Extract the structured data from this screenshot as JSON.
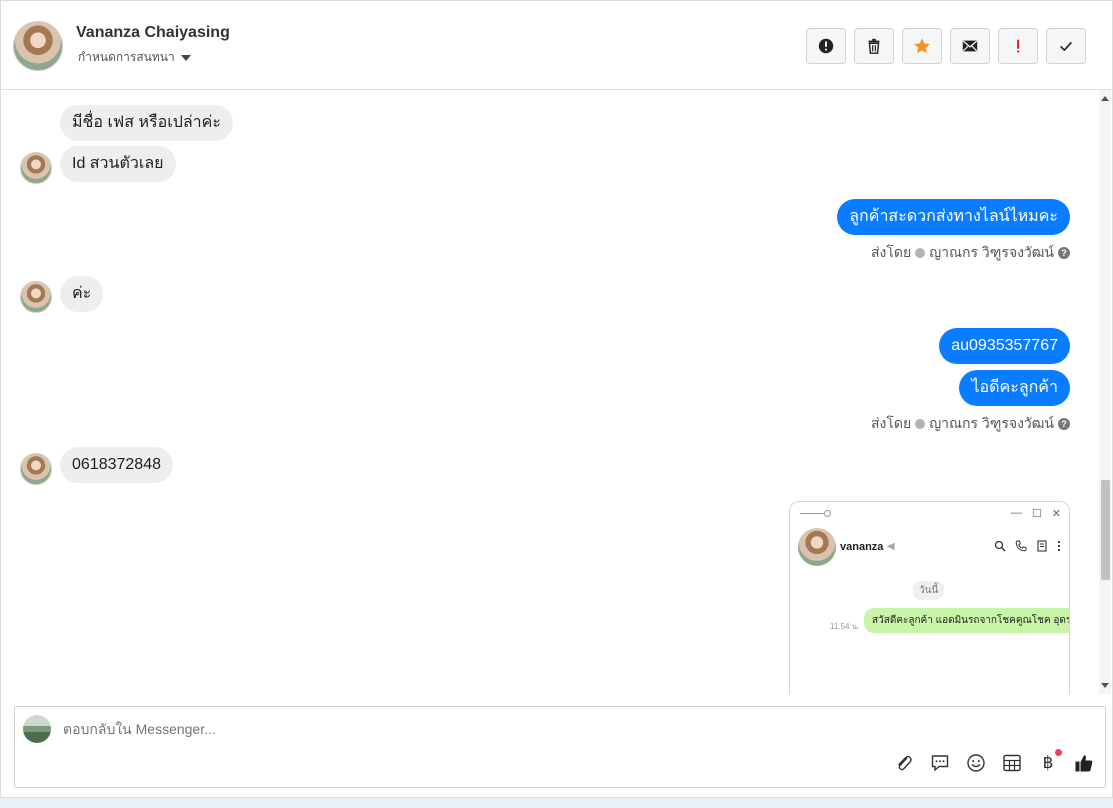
{
  "header": {
    "contact_name": "Vananza Chaiyasing",
    "assign_label": "กำหนดการสนทนา"
  },
  "actions": [
    {
      "name": "report-icon",
      "label": "!"
    },
    {
      "name": "trash-icon",
      "label": ""
    },
    {
      "name": "star-icon",
      "label": ""
    },
    {
      "name": "mail-icon",
      "label": ""
    },
    {
      "name": "important-icon",
      "label": "!"
    },
    {
      "name": "check-icon",
      "label": ""
    }
  ],
  "messages": {
    "m1": "มีชื่อ  เฟส หรือเปล่าค่ะ",
    "m2": "Id สวนตัวเลย",
    "m3": "ลูกค้าสะดวกส่งทางไลน์ไหมคะ",
    "m4": "ค่ะ",
    "m5": "au0935357767",
    "m6": "ไอดีคะลูกค้า",
    "m7": "0618372848"
  },
  "sent_by": {
    "label": "ส่งโดย",
    "agent": "ญาณกร วิฑูรจงวัฒน์",
    "help": "?"
  },
  "attachment": {
    "contact": "vananza",
    "date_label": "วันนี้",
    "time": "11.54 น.",
    "message": "สวัสดีคะลูกค้า แอดมินรถจากโชคคูณโชค อุดรคะ",
    "window_controls": [
      "—",
      "☐",
      "✕"
    ]
  },
  "composer": {
    "placeholder": "ตอบกลับใน Messenger...",
    "tools": [
      "paperclip-icon",
      "speech-bubble-icon",
      "emoji-icon",
      "table-icon",
      "baht-icon",
      "thumbs-up-icon"
    ],
    "baht_symbol": "฿"
  },
  "colors": {
    "outgoing": "#0a7cff",
    "incoming": "#eeeeee",
    "star": "#f7931e",
    "important": "#e02020"
  }
}
